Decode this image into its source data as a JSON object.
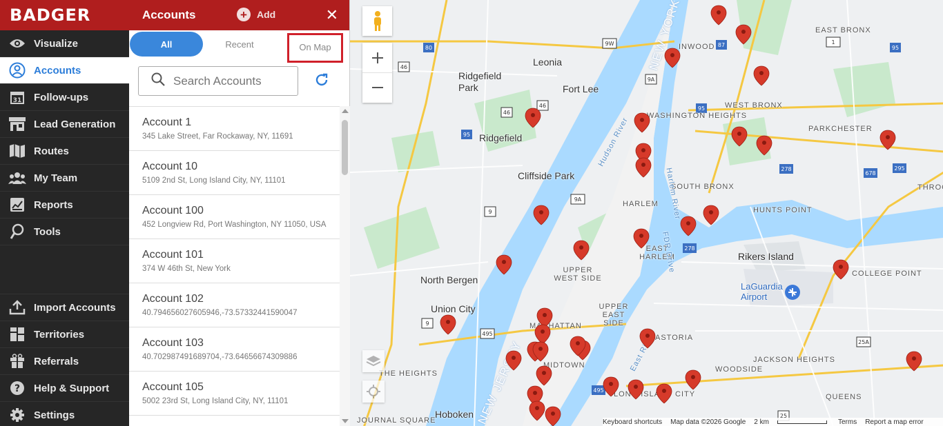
{
  "brand": {
    "logo": "BADGER"
  },
  "sidebar": {
    "items": [
      {
        "label": "Visualize",
        "icon": "eye-icon"
      },
      {
        "label": "Accounts",
        "icon": "user-circle-icon",
        "active": true
      },
      {
        "label": "Follow-ups",
        "icon": "calendar-icon"
      },
      {
        "label": "Lead Generation",
        "icon": "storefront-icon"
      },
      {
        "label": "Routes",
        "icon": "map-icon"
      },
      {
        "label": "My Team",
        "icon": "team-icon"
      },
      {
        "label": "Reports",
        "icon": "chart-icon"
      },
      {
        "label": "Tools",
        "icon": "pin-tool-icon"
      }
    ],
    "bottom_items": [
      {
        "label": "Import Accounts",
        "icon": "upload-icon"
      },
      {
        "label": "Territories",
        "icon": "grid-icon"
      },
      {
        "label": "Referrals",
        "icon": "gift-icon"
      },
      {
        "label": "Help & Support",
        "icon": "help-icon"
      },
      {
        "label": "Settings",
        "icon": "gear-icon"
      }
    ]
  },
  "panel": {
    "title": "Accounts",
    "add_label": "Add",
    "close_label": "✕",
    "tabs": {
      "all": "All",
      "recent": "Recent",
      "on_map": "On Map"
    },
    "search": {
      "placeholder": "Search Accounts",
      "value": ""
    },
    "accounts": [
      {
        "name": "Account 1",
        "address": "345 Lake Street, Far Rockaway, NY, 11691"
      },
      {
        "name": "Account 10",
        "address": "5109 2nd St, Long Island City, NY, 11101"
      },
      {
        "name": "Account 100",
        "address": "452 Longview Rd, Port Washington, NY 11050, USA"
      },
      {
        "name": "Account 101",
        "address": "374 W 46th St, New York"
      },
      {
        "name": "Account 102",
        "address": "40.794656027605946,-73.57332441590047"
      },
      {
        "name": "Account 103",
        "address": "40.702987491689704,-73.64656674309886"
      },
      {
        "name": "Account 105",
        "address": "5002 23rd St, Long Island City, NY, 11101"
      }
    ]
  },
  "map": {
    "labels": [
      "Ridgefield Park",
      "Leonia",
      "Fort Lee",
      "Ridgefield",
      "Cliffside Park",
      "North Bergen",
      "Union City",
      "Hoboken",
      "HARLEM",
      "EAST HARLEM",
      "UPPER WEST SIDE",
      "UPPER EAST SIDE",
      "MANHATTAN",
      "MIDTOWN",
      "ASTORIA",
      "JACKSON HEIGHTS",
      "WOODSIDE",
      "QUEENS",
      "INWOOD",
      "WASHINGTON HEIGHTS",
      "WEST BRONX",
      "EAST BRONX",
      "PARKCHESTER",
      "SOUTH BRONX",
      "HUNTS POINT",
      "Rikers Island",
      "LaGuardia Airport",
      "COLLEGE POINT",
      "THROGS NECK",
      "THE HEIGHTS",
      "JOURNAL SQUARE",
      "LONG ISLAND CITY",
      "NEW JERSEY",
      "NEW YORK",
      "Hudson River",
      "East River",
      "Harlem River",
      "FDR Drive"
    ],
    "footer": {
      "shortcuts": "Keyboard shortcuts",
      "data": "Map data ©2026 Google",
      "scale": "2 km",
      "terms": "Terms",
      "report": "Report a map error"
    },
    "colors": {
      "pin": "#d63a2a",
      "water": "#aadaff",
      "park": "#c4e8c8",
      "highway": "#ffe08a"
    }
  }
}
